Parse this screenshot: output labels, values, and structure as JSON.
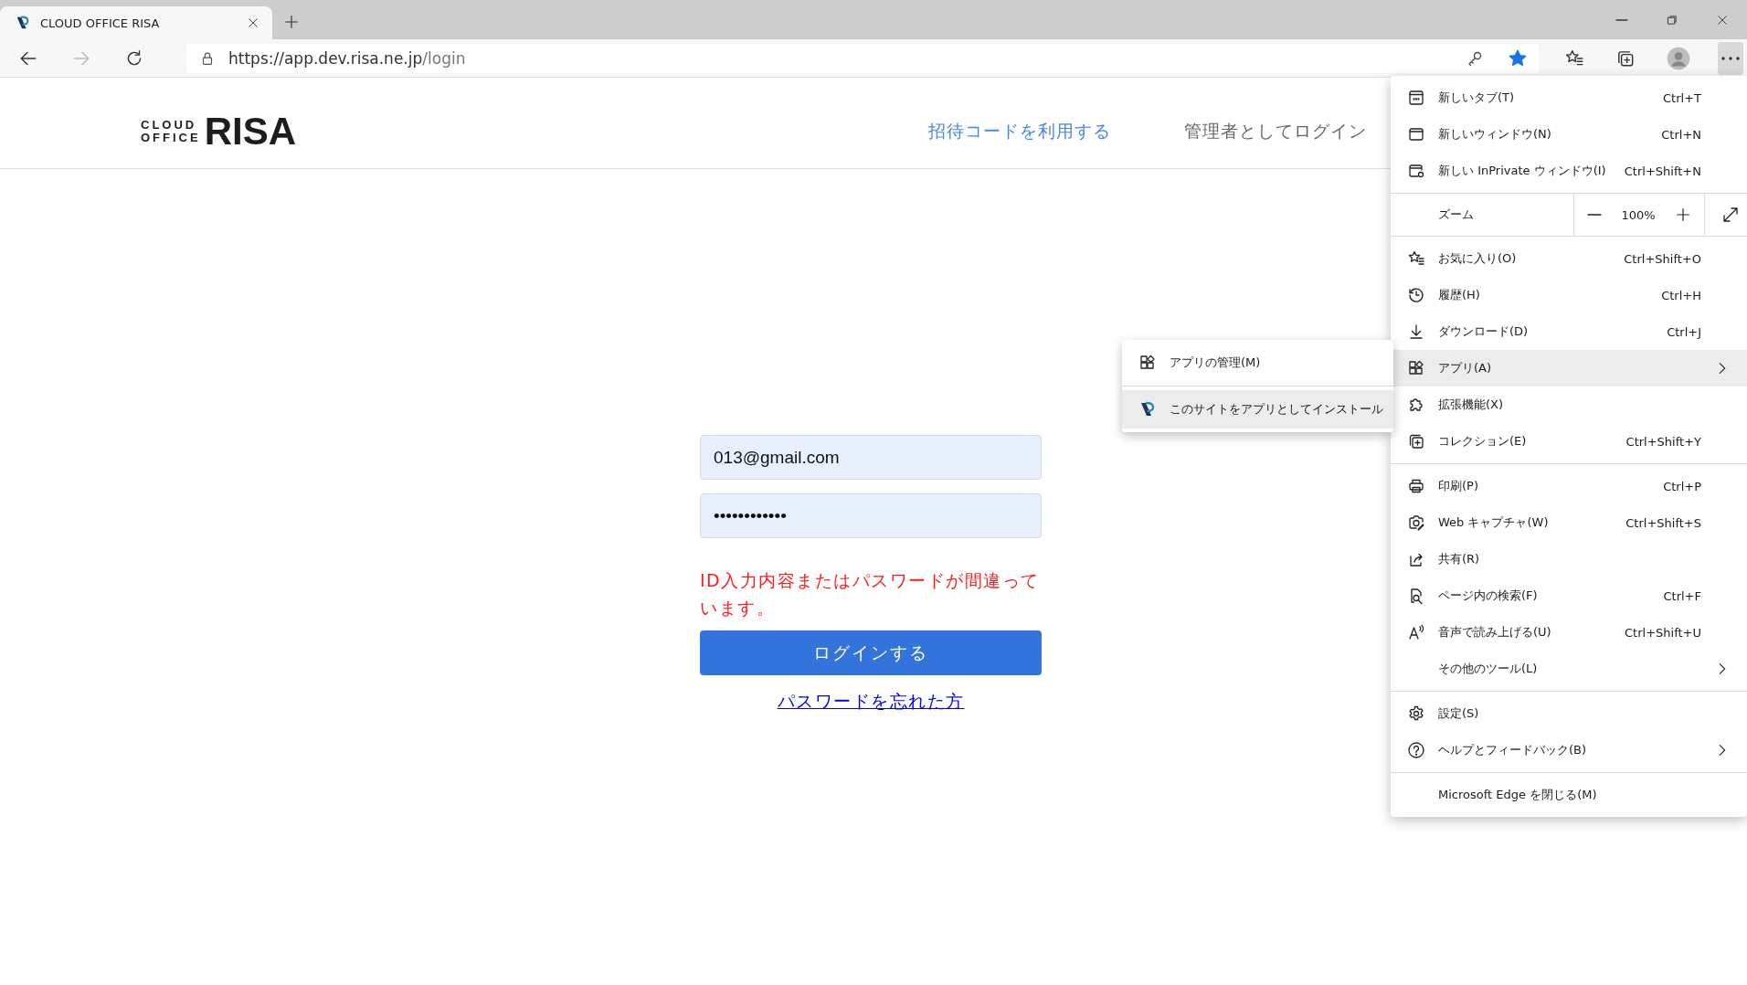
{
  "browser": {
    "tab": {
      "title": "CLOUD OFFICE RISA",
      "selected": true
    },
    "address_bar": {
      "host": "https://app.dev.risa.ne.jp",
      "path": "/login",
      "favorited": true
    },
    "menu_open": true
  },
  "page": {
    "logo": {
      "line_1": "CLOUD",
      "line_2": "OFFICE",
      "name": "RISA"
    },
    "nav": [
      {
        "label": "招待コードを利用する",
        "kind": "link"
      },
      {
        "label": "管理者としてログイン",
        "kind": "plain"
      }
    ],
    "form": {
      "email": "013@gmail.com",
      "password": "••••••••••••",
      "error": "ID入力内容またはパスワードが間違っています。",
      "submit": "ログインする",
      "forgot": "パスワードを忘れた方"
    }
  },
  "menu": {
    "sections": [
      {
        "items": [
          {
            "label": "新しいタブ(T)",
            "shortcut": "Ctrl+T",
            "submenu": false,
            "selected": false
          },
          {
            "label": "新しいウィンドウ(N)",
            "shortcut": "Ctrl+N",
            "submenu": false,
            "selected": false
          },
          {
            "label": "新しい InPrivate ウィンドウ(I)",
            "shortcut": "Ctrl+Shift+N",
            "submenu": false,
            "selected": false
          }
        ]
      },
      {
        "kind": "zoom",
        "label": "ズーム",
        "value": "100%"
      },
      {
        "items": [
          {
            "label": "お気に入り(O)",
            "shortcut": "Ctrl+Shift+O",
            "submenu": false,
            "selected": false
          },
          {
            "label": "履歴(H)",
            "shortcut": "Ctrl+H",
            "submenu": false,
            "selected": false
          },
          {
            "label": "ダウンロード(D)",
            "shortcut": "Ctrl+J",
            "submenu": false,
            "selected": false
          },
          {
            "label": "アプリ(A)",
            "submenu": true,
            "selected": true
          },
          {
            "label": "拡張機能(X)",
            "submenu": false,
            "selected": false
          },
          {
            "label": "コレクション(E)",
            "shortcut": "Ctrl+Shift+Y",
            "submenu": false,
            "selected": false
          }
        ]
      },
      {
        "items": [
          {
            "label": "印刷(P)",
            "shortcut": "Ctrl+P",
            "submenu": false,
            "selected": false
          },
          {
            "label": "Web キャプチャ(W)",
            "shortcut": "Ctrl+Shift+S",
            "submenu": false,
            "selected": false
          },
          {
            "label": "共有(R)",
            "submenu": false,
            "selected": false
          },
          {
            "label": "ページ内の検索(F)",
            "shortcut": "Ctrl+F",
            "submenu": false,
            "selected": false
          },
          {
            "label": "音声で読み上げる(U)",
            "shortcut": "Ctrl+Shift+U",
            "submenu": false,
            "selected": false
          },
          {
            "label": "その他のツール(L)",
            "submenu": true,
            "selected": false
          }
        ]
      },
      {
        "items": [
          {
            "label": "設定(S)",
            "submenu": false,
            "selected": false
          },
          {
            "label": "ヘルプとフィードバック(B)",
            "submenu": true,
            "selected": false
          }
        ]
      },
      {
        "items": [
          {
            "label": "Microsoft Edge を閉じる(M)",
            "submenu": false,
            "selected": false
          }
        ]
      }
    ],
    "submenu": [
      {
        "label": "アプリの管理(M)",
        "selected": false
      },
      {
        "label": "このサイトをアプリとしてインストール",
        "selected": true
      }
    ]
  }
}
